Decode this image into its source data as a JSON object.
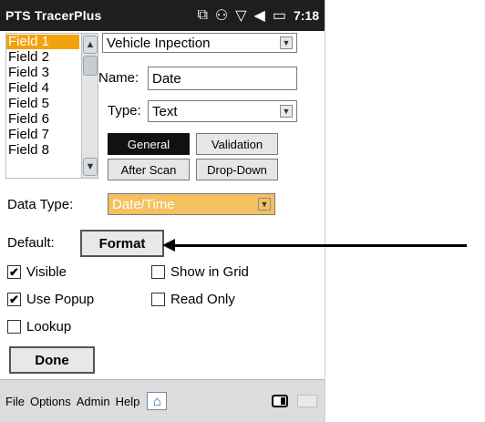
{
  "window": {
    "title": "PTS TracerPlus",
    "clock": "7:18"
  },
  "status_icons": [
    "sync-icon",
    "connectivity-icon",
    "signal-icon",
    "volume-icon",
    "battery-icon"
  ],
  "field_list": {
    "items": [
      "Field 1",
      "Field 2",
      "Field 3",
      "Field 4",
      "Field 5",
      "Field 6",
      "Field 7",
      "Field 8"
    ],
    "selected": "Field 1"
  },
  "form": {
    "template_select": "Vehicle Inpection",
    "name_label": "Name:",
    "name_value": "Date",
    "type_label": "Type:",
    "type_value": "Text",
    "buttons": {
      "general": "General",
      "validation": "Validation",
      "after_scan": "After Scan",
      "drop_down": "Drop-Down"
    },
    "data_type_label": "Data Type:",
    "data_type_value": "Date/Time",
    "default_label": "Default:",
    "format_button": "Format",
    "checkboxes": {
      "visible": {
        "label": "Visible",
        "checked": true
      },
      "show_in_grid": {
        "label": "Show in Grid",
        "checked": false
      },
      "use_popup": {
        "label": "Use Popup",
        "checked": true
      },
      "read_only": {
        "label": "Read Only",
        "checked": false
      },
      "lookup": {
        "label": "Lookup",
        "checked": false
      }
    },
    "done_button": "Done"
  },
  "menubar": {
    "file": "File",
    "options": "Options",
    "admin": "Admin",
    "help": "Help"
  },
  "colors": {
    "selection": "#f2a20c",
    "title_bar": "#1e1e1e",
    "datatype_bg": "#f5c060"
  }
}
